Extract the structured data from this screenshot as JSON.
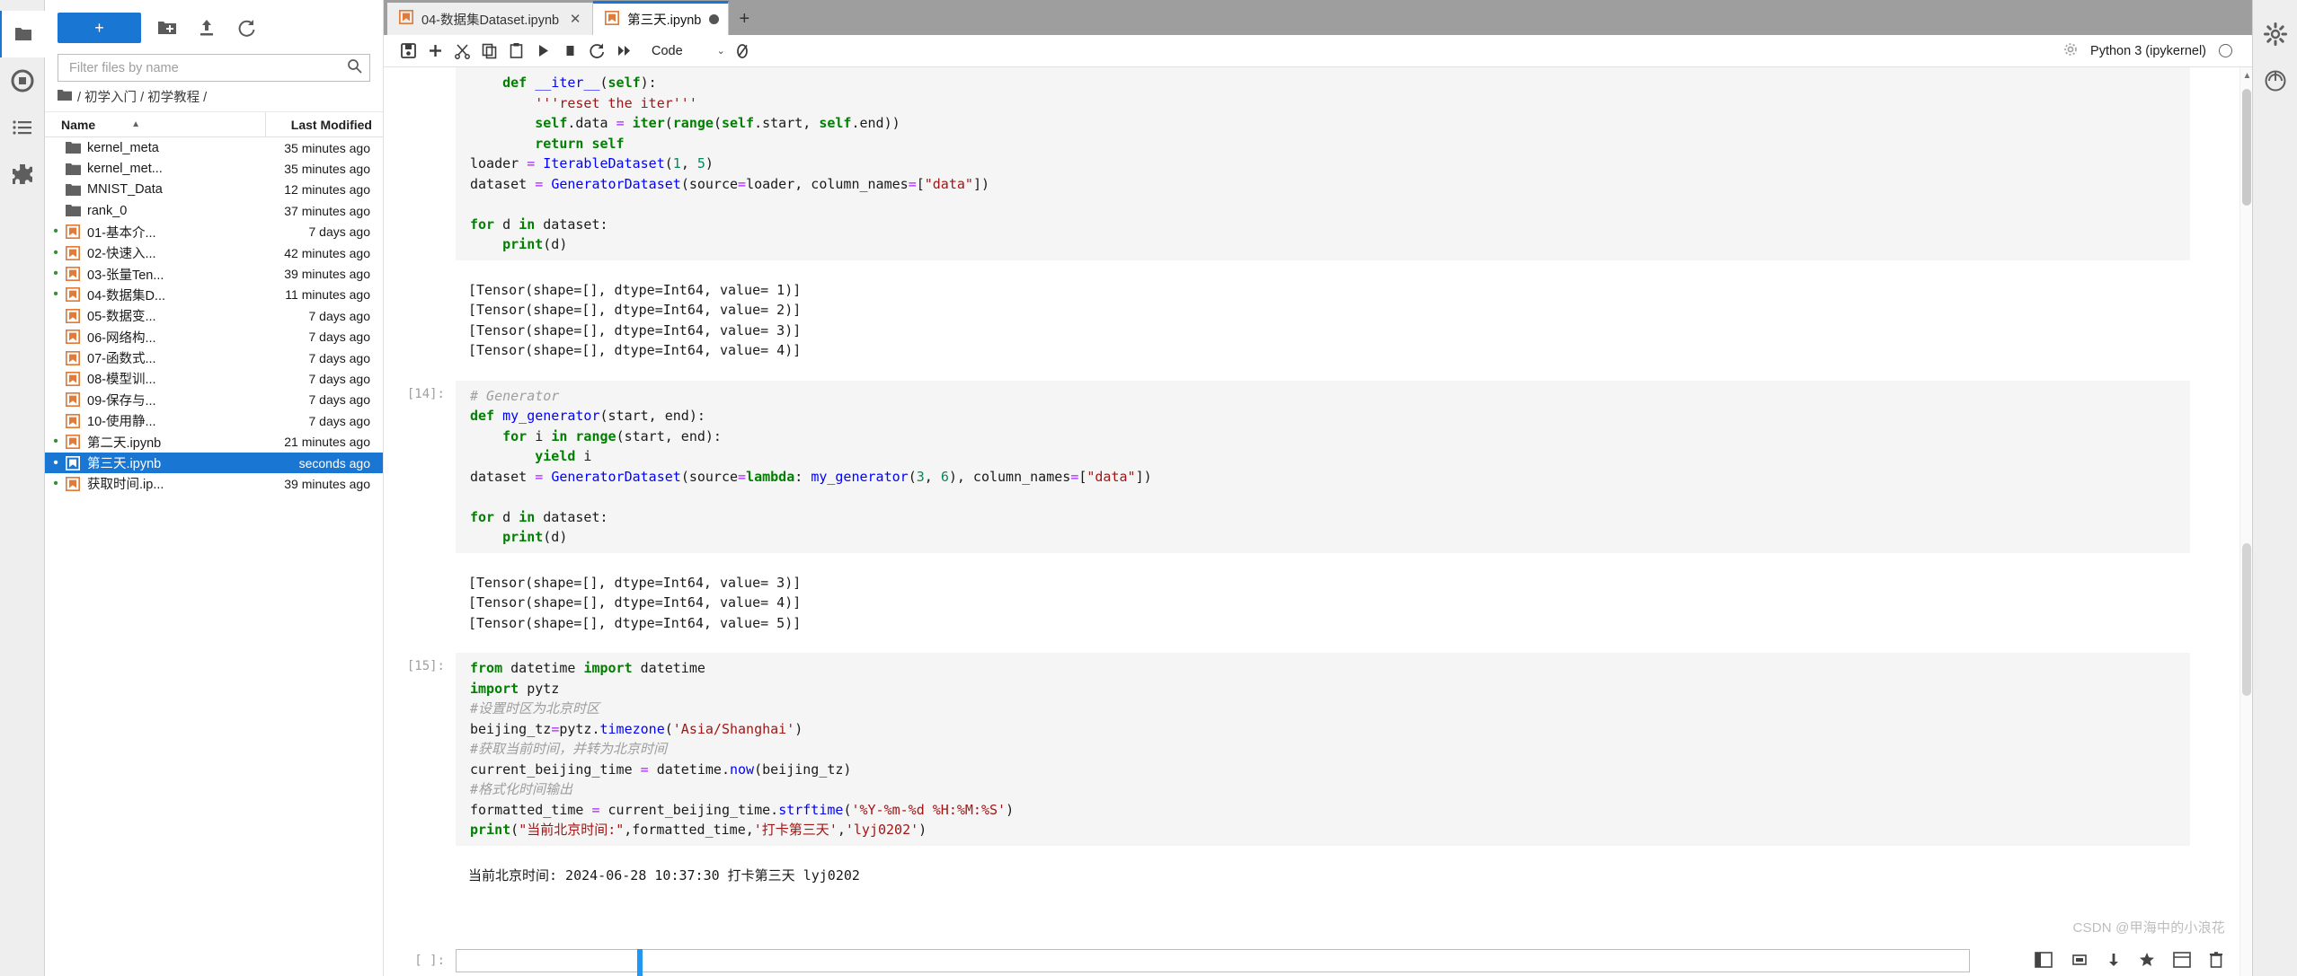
{
  "activity_bar": {
    "items": [
      {
        "name": "file-browser-icon",
        "label": "Files"
      },
      {
        "name": "running-terminals-icon",
        "label": "Running Terminals and Kernels"
      },
      {
        "name": "table-of-contents-icon",
        "label": "Table of Contents"
      },
      {
        "name": "extension-manager-icon",
        "label": "Extension Manager"
      }
    ]
  },
  "file_browser": {
    "new_launcher_label": "+",
    "toolbar_icons": [
      {
        "name": "new-folder-icon",
        "label": "New Folder"
      },
      {
        "name": "upload-icon",
        "label": "Upload Files"
      },
      {
        "name": "refresh-icon",
        "label": "Refresh File List"
      }
    ],
    "filter": {
      "placeholder": "Filter files by name",
      "value": "",
      "icon": "search-icon"
    },
    "breadcrumb": {
      "home_icon": "folder-icon",
      "path": "/ 初学入门 / 初学教程 /"
    },
    "columns": {
      "name": "Name",
      "last_modified": "Last Modified",
      "sort_caret": "▲"
    },
    "rows": [
      {
        "name": "kernel_meta",
        "modified": "35 minutes ago",
        "type": "folder",
        "running": false,
        "selected": false
      },
      {
        "name": "kernel_met...",
        "modified": "35 minutes ago",
        "type": "folder",
        "running": false,
        "selected": false
      },
      {
        "name": "MNIST_Data",
        "modified": "12 minutes ago",
        "type": "folder",
        "running": false,
        "selected": false
      },
      {
        "name": "rank_0",
        "modified": "37 minutes ago",
        "type": "folder",
        "running": false,
        "selected": false
      },
      {
        "name": "01-基本介...",
        "modified": "7 days ago",
        "type": "notebook",
        "running": true,
        "selected": false
      },
      {
        "name": "02-快速入...",
        "modified": "42 minutes ago",
        "type": "notebook",
        "running": true,
        "selected": false
      },
      {
        "name": "03-张量Ten...",
        "modified": "39 minutes ago",
        "type": "notebook",
        "running": true,
        "selected": false
      },
      {
        "name": "04-数据集D...",
        "modified": "11 minutes ago",
        "type": "notebook",
        "running": true,
        "selected": false
      },
      {
        "name": "05-数据变...",
        "modified": "7 days ago",
        "type": "notebook",
        "running": false,
        "selected": false
      },
      {
        "name": "06-网络构...",
        "modified": "7 days ago",
        "type": "notebook",
        "running": false,
        "selected": false
      },
      {
        "name": "07-函数式...",
        "modified": "7 days ago",
        "type": "notebook",
        "running": false,
        "selected": false
      },
      {
        "name": "08-模型训...",
        "modified": "7 days ago",
        "type": "notebook",
        "running": false,
        "selected": false
      },
      {
        "name": "09-保存与...",
        "modified": "7 days ago",
        "type": "notebook",
        "running": false,
        "selected": false
      },
      {
        "name": "10-使用静...",
        "modified": "7 days ago",
        "type": "notebook",
        "running": false,
        "selected": false
      },
      {
        "name": "第二天.ipynb",
        "modified": "21 minutes ago",
        "type": "notebook",
        "running": true,
        "selected": false
      },
      {
        "name": "第三天.ipynb",
        "modified": "seconds ago",
        "type": "notebook",
        "running": true,
        "selected": true
      },
      {
        "name": "获取时间.ip...",
        "modified": "39 minutes ago",
        "type": "notebook",
        "running": true,
        "selected": false
      }
    ]
  },
  "tabs": {
    "items": [
      {
        "label": "04-数据集Dataset.ipynb",
        "active": false,
        "dirty": false,
        "close_glyph": "✕"
      },
      {
        "label": "第三天.ipynb",
        "active": true,
        "dirty": true,
        "close_glyph": "✕"
      }
    ],
    "add_tab_label": "+"
  },
  "notebook_toolbar": {
    "icons": [
      {
        "name": "save-icon",
        "label": "Save"
      },
      {
        "name": "insert-cell-below-icon",
        "label": "Insert a cell below"
      },
      {
        "name": "cut-icon",
        "label": "Cut"
      },
      {
        "name": "copy-icon",
        "label": "Copy"
      },
      {
        "name": "paste-icon",
        "label": "Paste"
      },
      {
        "name": "run-icon",
        "label": "Run"
      },
      {
        "name": "interrupt-icon",
        "label": "Interrupt the kernel"
      },
      {
        "name": "restart-icon",
        "label": "Restart the kernel"
      },
      {
        "name": "restart-run-all-icon",
        "label": "Restart and run all"
      }
    ],
    "cell_type": "Code",
    "cell_type_chevron": "⌄",
    "git_icon": "git-diff-icon",
    "kernel_name": "Python 3 (ipykernel)",
    "settings_icon": "gear-icon",
    "kernel_status_icon": "kernel-idle-circle"
  },
  "notebook": {
    "cells": [
      {
        "prompt": "",
        "type": "code",
        "partial_top": true,
        "lines": [
          "    def __iter__(self):",
          "        '''reset the iter'''",
          "        self.data = iter(range(self.start, self.end))",
          "        return self",
          "loader = IterableDataset(1, 5)",
          "dataset = GeneratorDataset(source=loader, column_names=[\"data\"])",
          "",
          "for d in dataset:",
          "    print(d)"
        ]
      },
      {
        "prompt": "",
        "type": "output",
        "lines": [
          "[Tensor(shape=[], dtype=Int64, value= 1)]",
          "[Tensor(shape=[], dtype=Int64, value= 2)]",
          "[Tensor(shape=[], dtype=Int64, value= 3)]",
          "[Tensor(shape=[], dtype=Int64, value= 4)]"
        ]
      },
      {
        "prompt": "[14]:",
        "type": "code",
        "lines": [
          "# Generator",
          "def my_generator(start, end):",
          "    for i in range(start, end):",
          "        yield i",
          "dataset = GeneratorDataset(source=lambda: my_generator(3, 6), column_names=[\"data\"])",
          "",
          "for d in dataset:",
          "    print(d)"
        ]
      },
      {
        "prompt": "",
        "type": "output",
        "lines": [
          "[Tensor(shape=[], dtype=Int64, value= 3)]",
          "[Tensor(shape=[], dtype=Int64, value= 4)]",
          "[Tensor(shape=[], dtype=Int64, value= 5)]"
        ]
      },
      {
        "prompt": "[15]:",
        "type": "code",
        "lines": [
          "from datetime import datetime",
          "import pytz",
          "#设置时区为北京时区",
          "beijing_tz=pytz.timezone('Asia/Shanghai')",
          "#获取当前时间，并转为北京时间",
          "current_beijing_time = datetime.now(beijing_tz)",
          "#格式化时间输出",
          "formatted_time = current_beijing_time.strftime('%Y-%m-%d %H:%M:%S')",
          "print(\"当前北京时间:\",formatted_time,'打卡第三天','lyj0202')"
        ]
      },
      {
        "prompt": "",
        "type": "output",
        "lines": [
          "当前北京时间: 2024-06-28 10:37:30 打卡第三天 lyj0202"
        ]
      },
      {
        "prompt": "[ ]:",
        "type": "empty_input",
        "lines": [
          ""
        ]
      }
    ]
  },
  "right_bar": {
    "items": [
      {
        "name": "settings-gear-icon",
        "label": "Property Inspector"
      },
      {
        "name": "debugger-icon",
        "label": "Debugger"
      }
    ]
  },
  "bottom_status_icons": [
    {
      "name": "mode-indicator-icon"
    },
    {
      "name": "memory-icon"
    },
    {
      "name": "down-arrow-icon"
    },
    {
      "name": "star-icon"
    },
    {
      "name": "panel-icon"
    },
    {
      "name": "trash-icon"
    }
  ],
  "watermark": {
    "text": "CSDN @甲海中的小浪花"
  },
  "colors": {
    "accent": "#1976d2",
    "notebook_orange": "#e07b39",
    "running_dot": "#3c8c3c",
    "tab_bar_bg": "#9e9e9e",
    "cell_bg": "#f5f5f5"
  }
}
